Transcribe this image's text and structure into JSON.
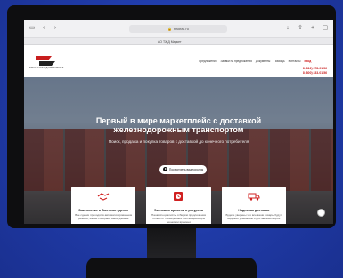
{
  "browser": {
    "url": "tradrail.ru",
    "tab_label": "АО ТЖД Маркет"
  },
  "header": {
    "logo_text": "ТРАНСЖЕЛДОРМАРКЕТ",
    "nav": [
      "Предложения",
      "Заявки на предложения",
      "Документы",
      "Помощь",
      "Контакты"
    ],
    "login_label": "Вход",
    "phones": [
      "8 (812) 378-01-56",
      "8 (800) 333-01-56"
    ]
  },
  "hero": {
    "title": "Первый в мире маркетплейс с доставкой железнодорожным транспортом",
    "subtitle": "Поиск, продажа и покупка товаров с доставкой до конечного потребителя",
    "cta_label": "Посмотреть видеоролик"
  },
  "cards": [
    {
      "icon": "handshake-icon",
      "title": "Заключение и быстрые сделки",
      "text": "Все сделки проходят в автоматизированном режиме, мы не собираем ваши данные"
    },
    {
      "icon": "clock-icon",
      "title": "Экономия времени и ресурсов",
      "text": "Наши специалисты отберём предложения только от проверенных поставщиков для экономии времени"
    },
    {
      "icon": "truck-icon",
      "title": "Надежная доставка",
      "text": "Будете уверены что все ваши товары будут надежно упакованы и доставлены в срок"
    }
  ],
  "colors": {
    "accent": "#d02020",
    "background": "#1f3aa6"
  }
}
